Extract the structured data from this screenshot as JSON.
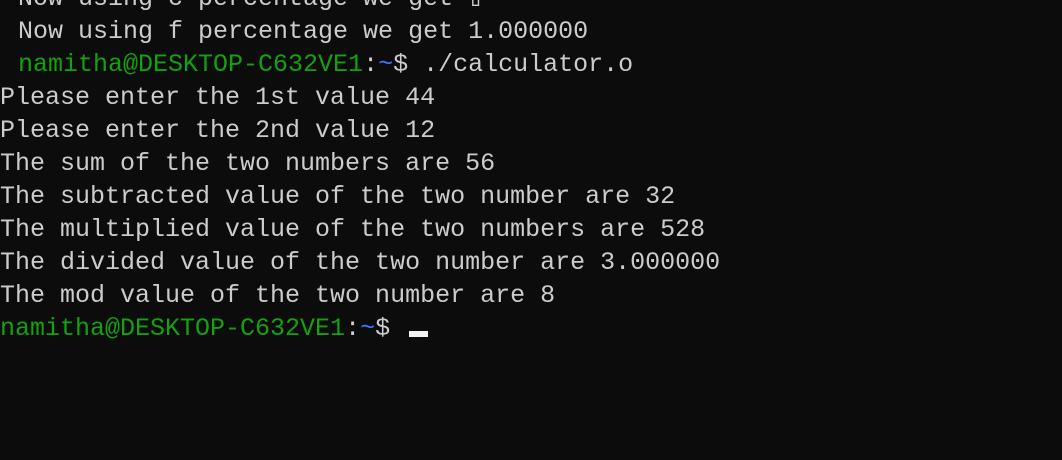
{
  "terminal": {
    "prompt": {
      "user_host": "namitha@DESKTOP-C632VE1",
      "colon": ":",
      "path": "~",
      "symbol": "$ "
    },
    "line_clipped": "Now using c percentage we get ▯",
    "line_f": "Now using f percentage we get 1.000000",
    "command": "./calculator.o",
    "output": [
      "Please enter the 1st value 44",
      "Please enter the 2nd value 12",
      "The sum of the two numbers are 56",
      "The subtracted value of the two number are 32",
      "The multiplied value of the two numbers are 528",
      "The divided value of the two number are 3.000000",
      "The mod value of the two number are 8"
    ],
    "colors": {
      "background": "#0c0c0c",
      "text": "#cccccc",
      "user_host": "#13a10e",
      "path": "#3b78ff"
    }
  }
}
